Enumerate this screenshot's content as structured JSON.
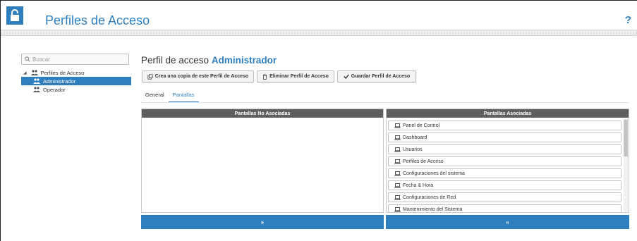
{
  "header": {
    "title": "Perfiles de Acceso",
    "help_label": "?",
    "lock_icon": "unlocked-padlock-icon",
    "accent": "#2f7fbf"
  },
  "sidebar": {
    "search_placeholder": "Buscar",
    "tree": {
      "root_label": "Perfiles de Acceso",
      "children": [
        {
          "label": "Administrador",
          "selected": true
        },
        {
          "label": "Operador",
          "selected": false
        }
      ]
    }
  },
  "main": {
    "title_prefix": "Perfil de acceso",
    "title_name": "Administrador",
    "buttons": {
      "copy_label": "Crea una copia de este Perfil de Acceso",
      "delete_label": "Eliminar Perfil de Acceso",
      "save_label": "Guardar Perfil de Acceso"
    },
    "tabs": [
      {
        "label": "General",
        "active": false
      },
      {
        "label": "Pantallas",
        "active": true
      }
    ],
    "panels": {
      "unassigned_header": "Pantallas No Asociadas",
      "assigned_header": "Pantallas Asociadas",
      "unassigned_items": [],
      "assigned_items": [
        "Panel de Control",
        "Dashboard",
        "Usuarios",
        "Perfiles de Acceso",
        "Configuraciones del sistema",
        "Fecha & Hora",
        "Configuraciones de Red",
        "Mantenimiento del Sistema"
      ],
      "move_right_label": "»",
      "move_left_label": "«"
    }
  }
}
